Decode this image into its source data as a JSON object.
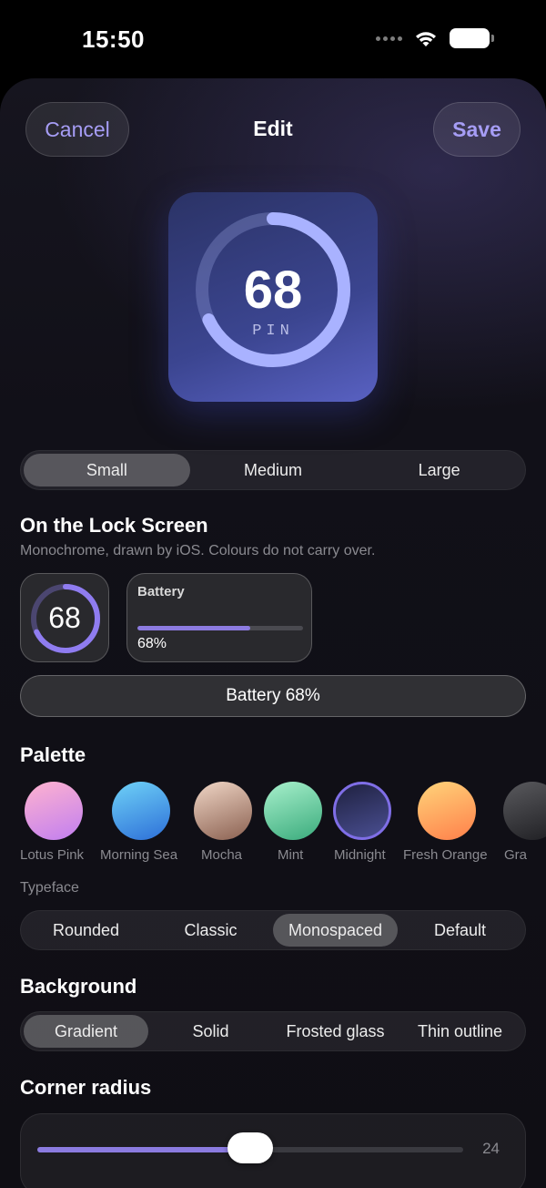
{
  "status_bar": {
    "time": "15:50",
    "icons": [
      "signal-dots",
      "wifi-icon",
      "battery-icon"
    ]
  },
  "header": {
    "cancel_label": "Cancel",
    "title": "Edit",
    "save_label": "Save"
  },
  "preview": {
    "value": "68",
    "caption": "PIN",
    "ring_progress": 0.68
  },
  "size_options": {
    "items": [
      "Small",
      "Medium",
      "Large"
    ],
    "selected": "Small"
  },
  "lock_screen": {
    "title": "On the Lock Screen",
    "subtitle": "Monochrome, drawn by iOS. Colours do not carry over.",
    "circular": {
      "value": "68",
      "progress": 0.68
    },
    "rectangular": {
      "title": "Battery",
      "value": "68%",
      "progress": 0.68
    },
    "inline_text": "Battery 68%"
  },
  "palette": {
    "title": "Palette",
    "selected": "Midnight",
    "swatches": [
      {
        "label": "Lotus Pink",
        "colors": [
          "#ffb3cf",
          "#c17ef0"
        ]
      },
      {
        "label": "Morning Sea",
        "colors": [
          "#6fd2f7",
          "#2d6fd8"
        ]
      },
      {
        "label": "Mocha",
        "colors": [
          "#f0d6c6",
          "#8a6050"
        ]
      },
      {
        "label": "Mint",
        "colors": [
          "#a8f0cc",
          "#3aab7c"
        ]
      },
      {
        "label": "Midnight",
        "colors": [
          "#1f2140",
          "#4a4f92"
        ]
      },
      {
        "label": "Fresh Orange",
        "colors": [
          "#ffd47a",
          "#ff7f4a"
        ]
      },
      {
        "label": "Gra",
        "colors": [
          "#5a5a5e",
          "#1e1e22"
        ]
      }
    ]
  },
  "typeface": {
    "label": "Typeface",
    "items": [
      "Rounded",
      "Classic",
      "Monospaced",
      "Default"
    ],
    "selected": "Monospaced"
  },
  "background": {
    "title": "Background",
    "items": [
      "Gradient",
      "Solid",
      "Frosted glass",
      "Thin outline"
    ],
    "selected": "Gradient"
  },
  "corner_radius": {
    "title": "Corner radius",
    "value": "24",
    "fraction": 0.5
  },
  "colors": {
    "accent": "#a69df5",
    "slider_fill": "#8b7be0",
    "ring": "#a9b2ff"
  }
}
